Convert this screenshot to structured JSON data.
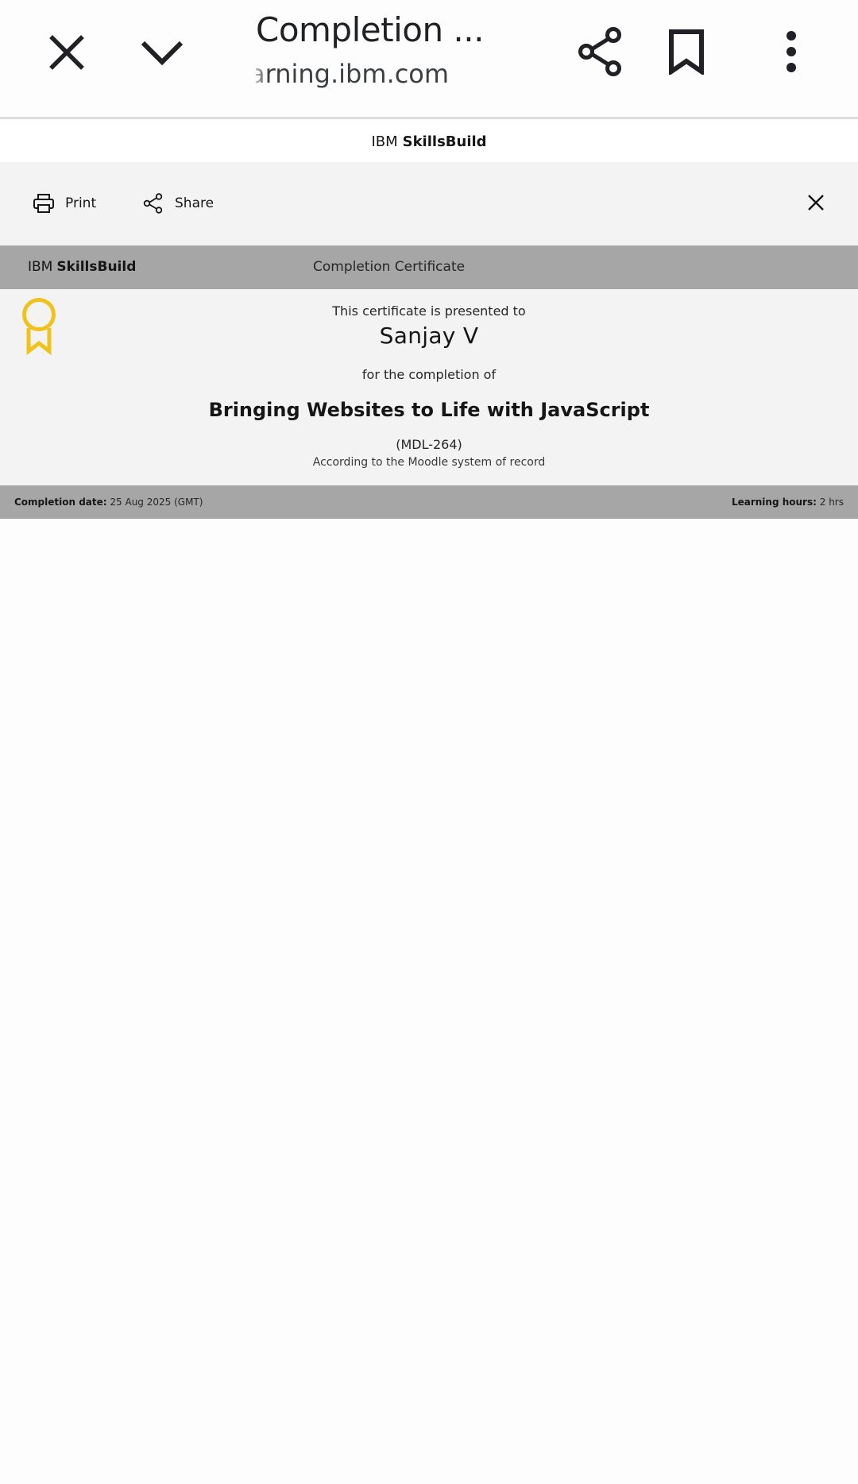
{
  "browser": {
    "title": "Completion ...",
    "url": "arning.ibm.com"
  },
  "header": {
    "brand_prefix": "IBM",
    "brand_name": "SkillsBuild"
  },
  "toolbar": {
    "print_label": "Print",
    "share_label": "Share"
  },
  "certificate": {
    "brand_prefix": "IBM",
    "brand_name": "SkillsBuild",
    "kind": "Completion Certificate",
    "presented_text": "This certificate is presented to",
    "recipient": "Sanjay V",
    "for_text": "for the completion of",
    "course_title": "Bringing Websites to Life with JavaScript",
    "course_code": "(MDL-264)",
    "record_text": "According to the Moodle system of record",
    "completion_date_label": "Completion date:",
    "completion_date": "25 Aug 2025 (GMT)",
    "learning_hours_label": "Learning hours:",
    "learning_hours": "2 hrs",
    "badge_color": "#f1c21b"
  },
  "icons": {
    "close": "close-icon",
    "minimize": "chevron-down-icon",
    "share": "share-icon",
    "bookmark": "bookmark-icon",
    "more": "more-vert-icon",
    "print": "printer-icon",
    "badge": "ribbon-badge-icon"
  }
}
